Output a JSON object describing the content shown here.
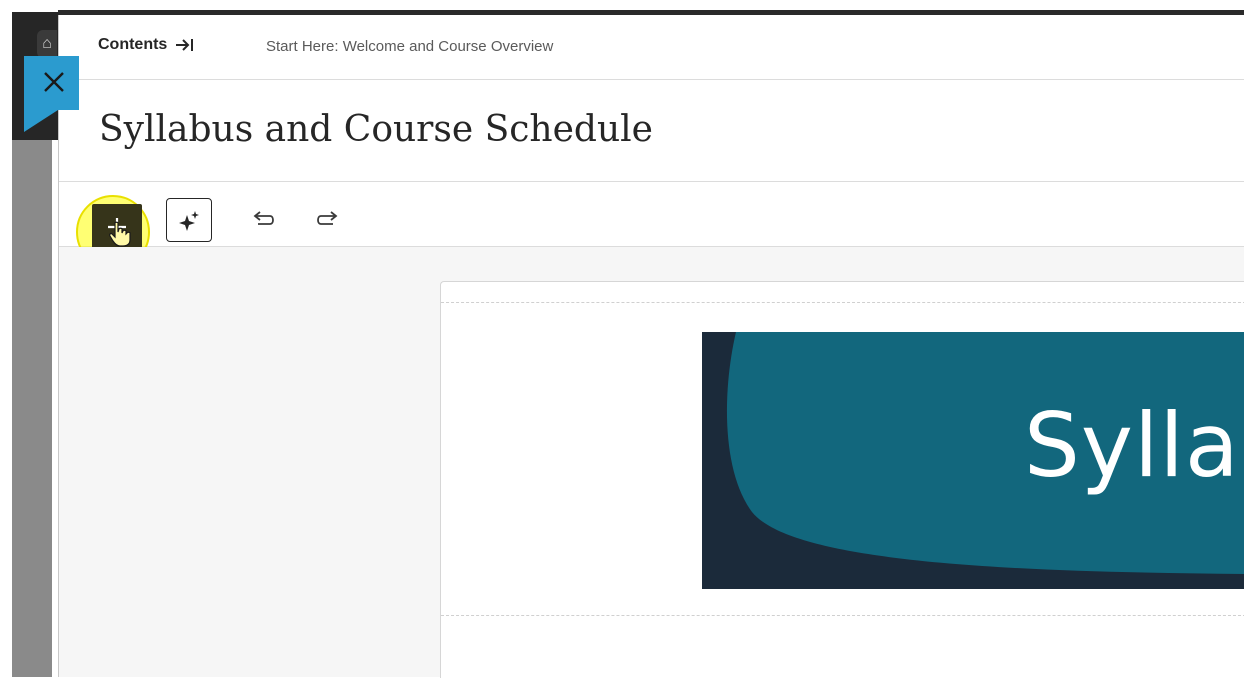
{
  "background_app": {
    "home_icon": "home-icon"
  },
  "close_tab": {
    "icon": "close-icon",
    "color": "#2b9bcf"
  },
  "breadcrumb": {
    "contents_label": "Contents",
    "contents_icon": "arrow-right-to-line-icon",
    "current_item": "Start Here: Welcome and Course Overview"
  },
  "page": {
    "title": "Syllabus and Course Schedule"
  },
  "toolbar": {
    "add_icon": "plus-icon",
    "ai_icon": "sparkle-icon",
    "undo_icon": "undo-icon",
    "redo_icon": "redo-icon",
    "add_button_color": "#36341a",
    "highlight_color": "#ffff00"
  },
  "banner": {
    "text": "Sylla",
    "dark_color": "#1b2a3a",
    "teal_color": "#12677d"
  }
}
